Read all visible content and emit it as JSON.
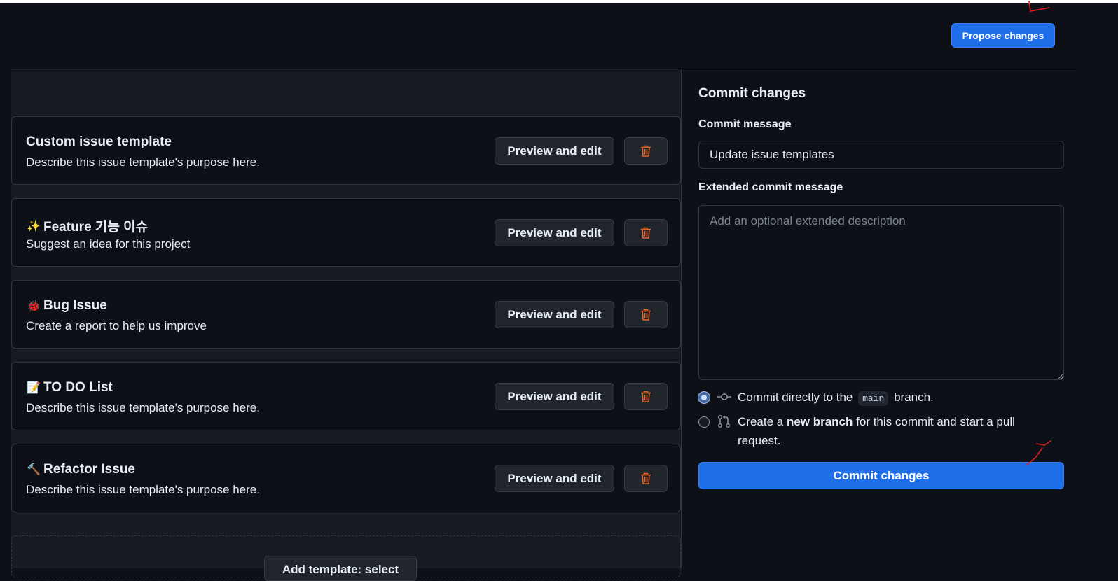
{
  "header": {
    "propose_changes_label": "Propose changes"
  },
  "templates": [
    {
      "emoji": "",
      "title": "Custom issue template",
      "description": "Describe this issue template's purpose here.",
      "preview_label": "Preview and edit"
    },
    {
      "emoji": "✨",
      "title": "Feature 기능 이슈",
      "description": "Suggest an idea for this project",
      "preview_label": "Preview and edit"
    },
    {
      "emoji": "🐞",
      "title": "Bug Issue",
      "description": "Create a report to help us improve",
      "preview_label": "Preview and edit"
    },
    {
      "emoji": "📝",
      "title": "TO DO List",
      "description": "Describe this issue template's purpose here.",
      "preview_label": "Preview and edit"
    },
    {
      "emoji": "🔨",
      "title": "Refactor Issue",
      "description": "Describe this issue template's purpose here.",
      "preview_label": "Preview and edit"
    }
  ],
  "add_template_label": "Add template: select",
  "commit_panel": {
    "heading": "Commit changes",
    "message_label": "Commit message",
    "message_value": "Update issue templates",
    "extended_label": "Extended commit message",
    "extended_placeholder": "Add an optional extended description",
    "option_direct": {
      "prefix": "Commit directly to the",
      "branch": "main",
      "suffix": "branch."
    },
    "option_new_branch": {
      "prefix": "Create a",
      "bold": "new branch",
      "suffix": "for this commit and start a pull request."
    },
    "commit_button_label": "Commit changes"
  },
  "colors": {
    "background": "#0d1117",
    "panel": "#161b22",
    "accent": "#1f6feb",
    "danger_icon": "#e5662a",
    "annotation": "#e0201d"
  },
  "icons": {
    "delete": "trash-icon",
    "commit": "git-commit-icon",
    "pull_request": "git-pull-request-icon"
  }
}
